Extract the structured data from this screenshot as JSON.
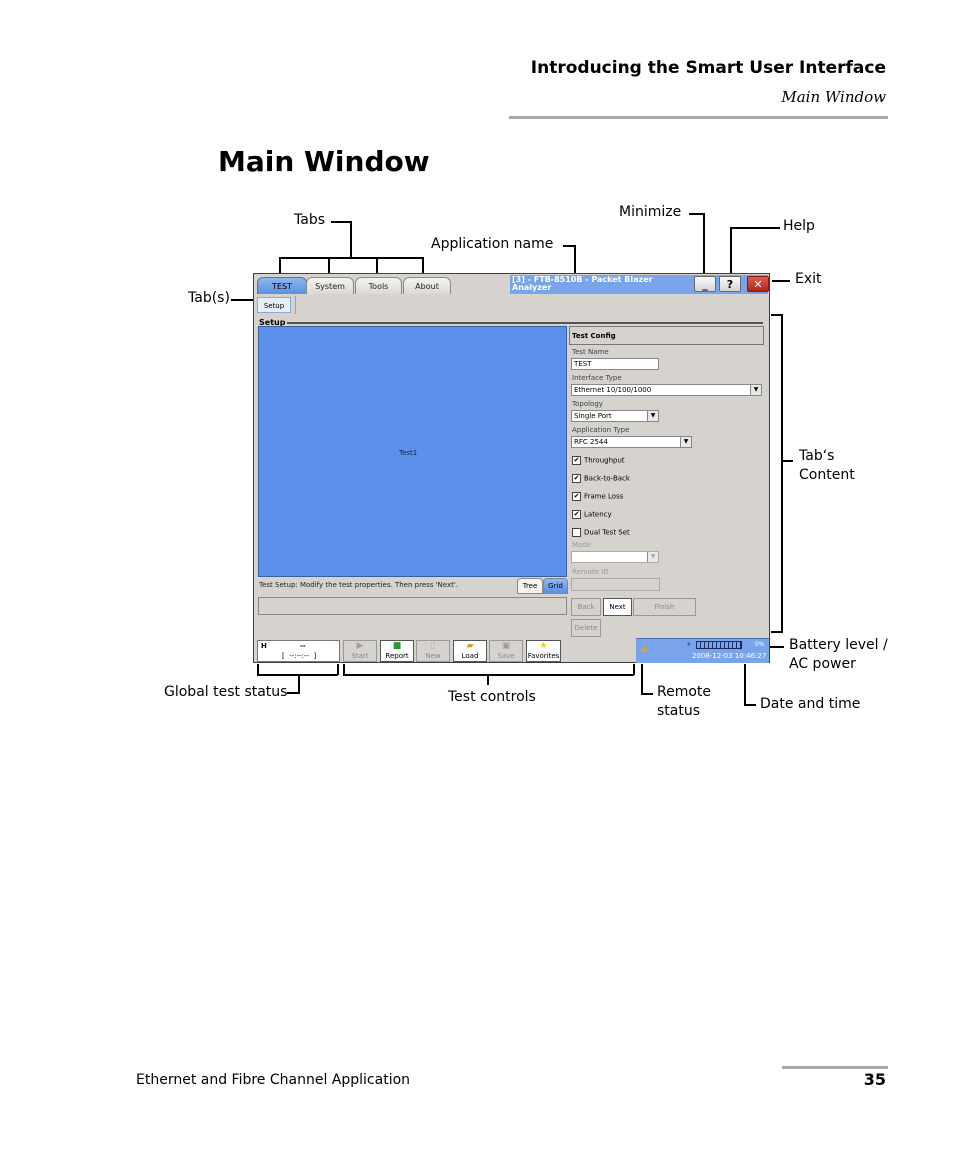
{
  "page": {
    "header_title": "Introducing the Smart User Interface",
    "header_subtitle": "Main Window",
    "title": "Main Window",
    "footer_text": "Ethernet and Fibre Channel Application",
    "page_number": "35"
  },
  "annotations": {
    "tabs": "Tabs",
    "tab_s": "Tab(s)",
    "application_name": "Application name",
    "minimize": "Minimize",
    "help": "Help",
    "exit": "Exit",
    "tabs_content_1": "Tab‘s",
    "tabs_content_2": "Content",
    "battery_1": "Battery level /",
    "battery_2": "AC power",
    "global_test_status": "Global test status",
    "test_controls": "Test controls",
    "remote_status_1": "Remote",
    "remote_status_2": "status",
    "date_time": "Date and time"
  },
  "app": {
    "tabs": [
      {
        "label": "TEST",
        "active": true
      },
      {
        "label": "System",
        "active": false
      },
      {
        "label": "Tools",
        "active": false
      },
      {
        "label": "About",
        "active": false
      }
    ],
    "app_name_line1": "[3] - FTB-8510B - Packet Blazer",
    "app_name_line2": "Analyzer",
    "window_buttons": {
      "minimize": "_",
      "help": "?",
      "exit": "✕"
    },
    "subtab": "Setup",
    "group_label": "Setup",
    "canvas_item": "Test1",
    "hint": "Test Setup: Modify the test properties. Then press 'Next'.",
    "view_buttons": {
      "tree": "Tree",
      "grid": "Grid",
      "selected": "Grid"
    },
    "config": {
      "header": "Test Config",
      "test_name_label": "Test Name",
      "test_name_value": "TEST",
      "interface_type_label": "Interface Type",
      "interface_type_value": "Ethernet 10/100/1000",
      "topology_label": "Topology",
      "topology_value": "Single Port",
      "application_type_label": "Application Type",
      "application_type_value": "RFC 2544",
      "checkboxes": [
        {
          "label": "Throughput",
          "checked": true
        },
        {
          "label": "Back-to-Back",
          "checked": true
        },
        {
          "label": "Frame Loss",
          "checked": true
        },
        {
          "label": "Latency",
          "checked": true
        },
        {
          "label": "Dual Test Set",
          "checked": false
        }
      ],
      "mode_label": "Mode",
      "mode_value": "",
      "remote_id_label": "Remote ID",
      "remote_id_value": "",
      "buttons": {
        "back": "Back",
        "next": "Next",
        "finish": "Finish",
        "delete": "Delete"
      }
    },
    "global_status": {
      "indicator": "H",
      "value": "--",
      "timer": "[  --:--:--  ]"
    },
    "test_controls": [
      {
        "label": "Start",
        "icon": "play-icon",
        "enabled": false
      },
      {
        "label": "Report",
        "icon": "report-icon",
        "enabled": true
      },
      {
        "label": "New",
        "icon": "new-file-icon",
        "enabled": false
      },
      {
        "label": "Load",
        "icon": "folder-open-icon",
        "enabled": true
      },
      {
        "label": "Save",
        "icon": "save-icon",
        "enabled": false
      },
      {
        "label": "Favorites",
        "icon": "star-icon",
        "enabled": true
      }
    ],
    "status_bar": {
      "battery_percent": "0%",
      "datetime": "2008-12-03 10:46:27"
    }
  }
}
